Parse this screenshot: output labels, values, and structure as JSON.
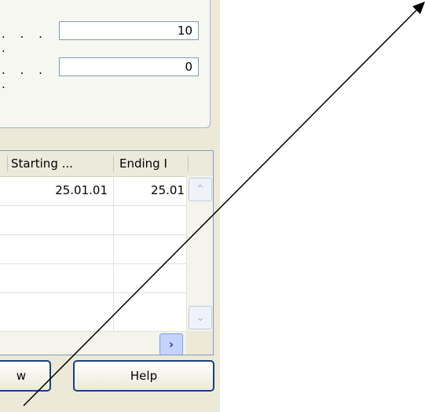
{
  "form": {
    "row1": {
      "dots": ". . . .",
      "value": "10"
    },
    "row2": {
      "dots": ". . . .",
      "value": "0"
    }
  },
  "grid": {
    "columns": [
      "Starting ...",
      "Ending I"
    ],
    "rows": [
      {
        "starting": "25.01.01",
        "ending": "25.01"
      },
      {
        "starting": "",
        "ending": ""
      },
      {
        "starting": "",
        "ending": ""
      },
      {
        "starting": "",
        "ending": ""
      },
      {
        "starting": "",
        "ending": ""
      }
    ],
    "icons": {
      "scroll_up": "chevron-up-icon",
      "scroll_down": "chevron-down-icon",
      "scroll_right": "chevron-right-icon"
    }
  },
  "buttons": {
    "left_partial": "w",
    "help": "Help"
  },
  "colors": {
    "dialog_bg": "#ece9d8",
    "border_blue": "#1a3f83",
    "field_border": "#7f9db9"
  }
}
